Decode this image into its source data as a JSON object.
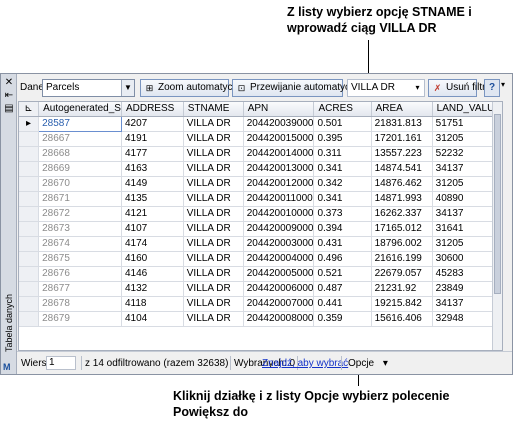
{
  "callouts": {
    "top": "Z listy wybierz opcję STNAME i wprowadź ciąg VILLA DR",
    "bottom": "Kliknij działkę i z listy Opcje wybierz polecenie Powiększ do"
  },
  "side": {
    "title": "Tabela danych",
    "icons": [
      "close-icon",
      "pin-icon",
      "properties-icon"
    ]
  },
  "toolbar": {
    "data_label": "Dane:",
    "data_value": "Parcels",
    "zoom_auto": "Zoom automatyczny",
    "pan_auto": "Przewijanie automatyczne",
    "filter_value": "VILLA DR",
    "remove_filter": "Usuń filtr",
    "help": "?"
  },
  "table": {
    "columns": [
      "Autogenerated_S",
      "ADDRESS",
      "STNAME",
      "APN",
      "ACRES",
      "AREA",
      "LAND_VALUE"
    ],
    "rows": [
      [
        "28587",
        "4207",
        "VILLA DR",
        "204420039000",
        "0.501",
        "21831.813",
        "51751"
      ],
      [
        "28667",
        "4191",
        "VILLA DR",
        "204420015000",
        "0.395",
        "17201.161",
        "31205"
      ],
      [
        "28668",
        "4177",
        "VILLA DR",
        "204420014000",
        "0.311",
        "13557.223",
        "52232"
      ],
      [
        "28669",
        "4163",
        "VILLA DR",
        "204420013000",
        "0.341",
        "14874.541",
        "34137"
      ],
      [
        "28670",
        "4149",
        "VILLA DR",
        "204420012000",
        "0.342",
        "14876.462",
        "31205"
      ],
      [
        "28671",
        "4135",
        "VILLA DR",
        "204420011000",
        "0.341",
        "14871.993",
        "40890"
      ],
      [
        "28672",
        "4121",
        "VILLA DR",
        "204420010000",
        "0.373",
        "16262.337",
        "34137"
      ],
      [
        "28673",
        "4107",
        "VILLA DR",
        "204420009000",
        "0.394",
        "17165.012",
        "31641"
      ],
      [
        "28674",
        "4174",
        "VILLA DR",
        "204420003000",
        "0.431",
        "18796.002",
        "31205"
      ],
      [
        "28675",
        "4160",
        "VILLA DR",
        "204420004000",
        "0.496",
        "21616.199",
        "30600"
      ],
      [
        "28676",
        "4146",
        "VILLA DR",
        "204420005000",
        "0.521",
        "22679.057",
        "45283"
      ],
      [
        "28677",
        "4132",
        "VILLA DR",
        "204420006000",
        "0.487",
        "21231.92",
        "23849"
      ],
      [
        "28678",
        "4118",
        "VILLA DR",
        "204420007000",
        "0.441",
        "19215.842",
        "34137"
      ],
      [
        "28679",
        "4104",
        "VILLA DR",
        "204420008000",
        "0.359",
        "15616.406",
        "32948"
      ]
    ]
  },
  "status": {
    "row_label": "Wiersz",
    "row_value": "1",
    "filtered": "z 14 odfiltrowano (razem 32638)",
    "selected": "Wybranych: 0",
    "find_link": "Znajdź, aby wybrać",
    "options": "Opcje",
    "options_arrow": "▾"
  }
}
